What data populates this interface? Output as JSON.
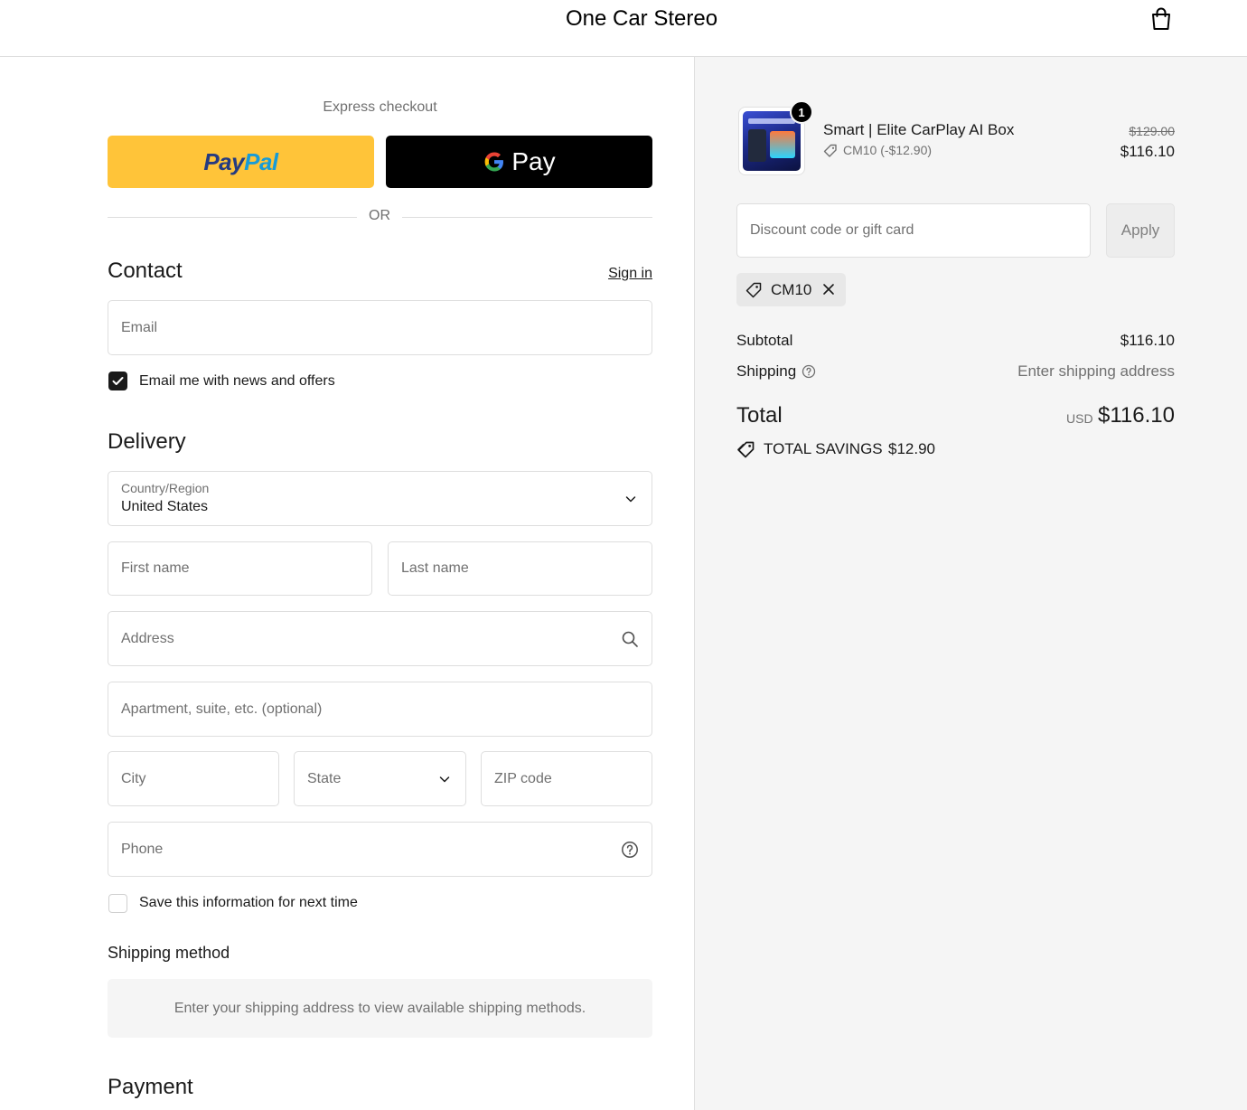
{
  "header": {
    "store_name": "One Car Stereo"
  },
  "express": {
    "title": "Express checkout",
    "paypal_pay": "Pay",
    "paypal_pal": "Pal",
    "gpay_text": "Pay",
    "or": "OR"
  },
  "contact": {
    "title": "Contact",
    "sign_in": "Sign in",
    "email_placeholder": "Email",
    "news_label": "Email me with news and offers"
  },
  "delivery": {
    "title": "Delivery",
    "country_label": "Country/Region",
    "country_value": "United States",
    "first_name": "First name",
    "last_name": "Last name",
    "address": "Address",
    "apartment": "Apartment, suite, etc. (optional)",
    "city": "City",
    "state": "State",
    "zip": "ZIP code",
    "phone": "Phone",
    "save_info": "Save this information for next time"
  },
  "shipping_method": {
    "title": "Shipping method",
    "notice": "Enter your shipping address to view available shipping methods."
  },
  "payment": {
    "title": "Payment"
  },
  "summary": {
    "product": {
      "quantity": "1",
      "name": "Smart |  Elite CarPlay AI Box",
      "discount": "CM10 (-$12.90)",
      "price_original": "$129.00",
      "price_final": "$116.10"
    },
    "discount_placeholder": "Discount code or gift card",
    "apply": "Apply",
    "applied_code": "CM10",
    "subtotal_label": "Subtotal",
    "subtotal_value": "$116.10",
    "shipping_label": "Shipping",
    "shipping_value": "Enter shipping address",
    "total_label": "Total",
    "currency": "USD",
    "total_value": "$116.10",
    "savings_label": "TOTAL SAVINGS",
    "savings_value": "$12.90"
  },
  "colors": {
    "paypal_yellow": "#ffc439",
    "paypal_dark": "#253b80",
    "paypal_light": "#179bd7",
    "text": "#1a1a1a",
    "muted": "#707070"
  }
}
